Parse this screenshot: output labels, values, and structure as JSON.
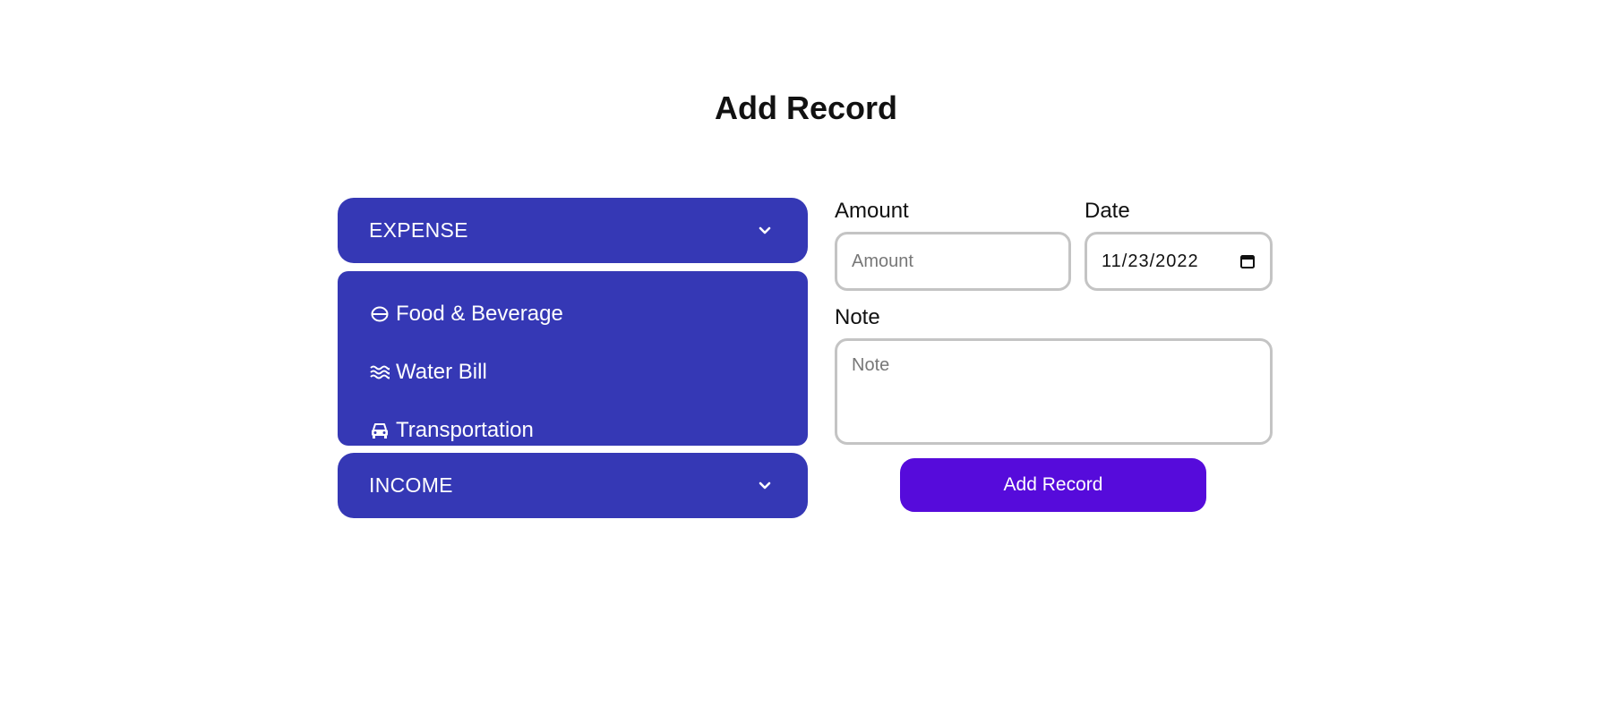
{
  "page": {
    "title": "Add Record"
  },
  "categories": {
    "expense": {
      "label": "EXPENSE",
      "icon": "chevron-down-icon",
      "expanded": true,
      "items": [
        {
          "label": "Food & Beverage",
          "icon": "bowl-icon"
        },
        {
          "label": "Water Bill",
          "icon": "water-waves-icon"
        },
        {
          "label": "Transportation",
          "icon": "car-icon"
        }
      ]
    },
    "income": {
      "label": "INCOME",
      "icon": "chevron-down-icon",
      "expanded": false
    }
  },
  "form": {
    "amount": {
      "label": "Amount",
      "placeholder": "Amount",
      "value": ""
    },
    "date": {
      "label": "Date",
      "value": "11/23/2022",
      "icon": "calendar-icon"
    },
    "note": {
      "label": "Note",
      "placeholder": "Note",
      "value": ""
    },
    "submit_label": "Add Record"
  },
  "colors": {
    "accordion_bg": "#3538b5",
    "button_bg": "#560bdb",
    "input_border": "#c4c4c4"
  }
}
